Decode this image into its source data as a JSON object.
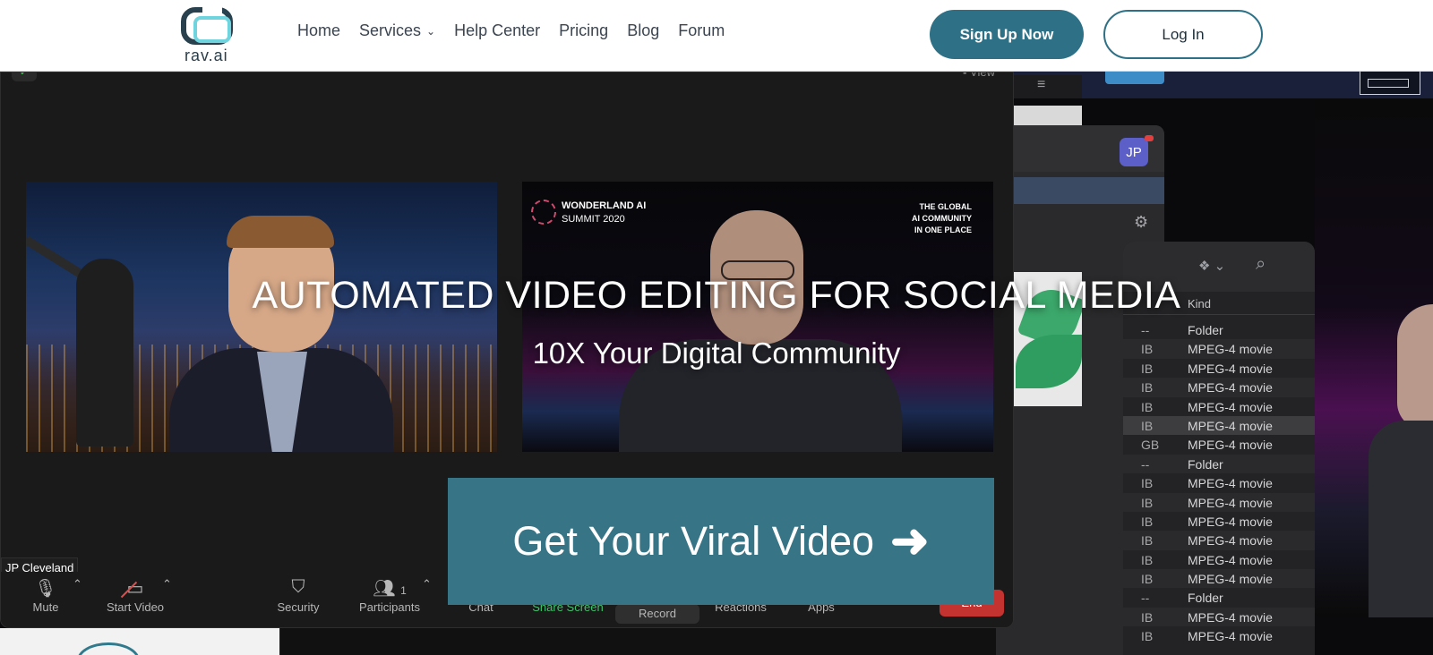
{
  "nav": {
    "logo_text": "rav.ai",
    "links": [
      {
        "label": "Home"
      },
      {
        "label": "Services"
      },
      {
        "label": "Help Center"
      },
      {
        "label": "Pricing"
      },
      {
        "label": "Blog"
      },
      {
        "label": "Forum"
      }
    ],
    "signup_label": "Sign Up Now",
    "login_label": "Log In"
  },
  "hero": {
    "title": "AUTOMATED VIDEO EDITING FOR SOCIAL MEDIA",
    "subtitle": "10X Your Digital Community",
    "cta_label": "Get Your Viral Video",
    "cta_arrow": "➜"
  },
  "zoom": {
    "view_label": "View",
    "participant_name": "JP Cleveland",
    "tile_right_brand": "WONDERLAND AI",
    "tile_right_brand_year": "SUMMIT 2020",
    "tile_right_tagline": [
      "THE GLOBAL",
      "AI COMMUNITY",
      "IN ONE PLACE"
    ],
    "toolbar": {
      "mute": "Mute",
      "start_video": "Start Video",
      "security": "Security",
      "participants": "Participants",
      "participants_count": "1",
      "chat": "Chat",
      "share_screen": "Share Screen",
      "record": "Record",
      "reactions": "Reactions",
      "apps": "Apps",
      "end": "End"
    }
  },
  "background": {
    "avatar_initials": "JP",
    "finder_column_kind": "Kind",
    "finder_rows": [
      {
        "size": "--",
        "kind": "Folder"
      },
      {
        "size": "IB",
        "kind": "MPEG-4 movie"
      },
      {
        "size": "IB",
        "kind": "MPEG-4 movie"
      },
      {
        "size": "IB",
        "kind": "MPEG-4 movie"
      },
      {
        "size": "IB",
        "kind": "MPEG-4 movie"
      },
      {
        "size": "IB",
        "kind": "MPEG-4 movie"
      },
      {
        "size": "GB",
        "kind": "MPEG-4 movie"
      },
      {
        "size": "--",
        "kind": "Folder"
      },
      {
        "size": "IB",
        "kind": "MPEG-4 movie"
      },
      {
        "size": "IB",
        "kind": "MPEG-4 movie"
      },
      {
        "size": "IB",
        "kind": "MPEG-4 movie"
      },
      {
        "size": "IB",
        "kind": "MPEG-4 movie"
      },
      {
        "size": "IB",
        "kind": "MPEG-4 movie"
      },
      {
        "size": "IB",
        "kind": "MPEG-4 movie"
      },
      {
        "size": "--",
        "kind": "Folder"
      },
      {
        "size": "IB",
        "kind": "MPEG-4 movie"
      },
      {
        "size": "IB",
        "kind": "MPEG-4 movie"
      }
    ]
  },
  "colors": {
    "brand_teal": "#2e7186",
    "cta_teal": "#377485",
    "logo_cyan": "#6fd4de",
    "share_green": "#3dc36b",
    "end_red": "#c53330"
  }
}
